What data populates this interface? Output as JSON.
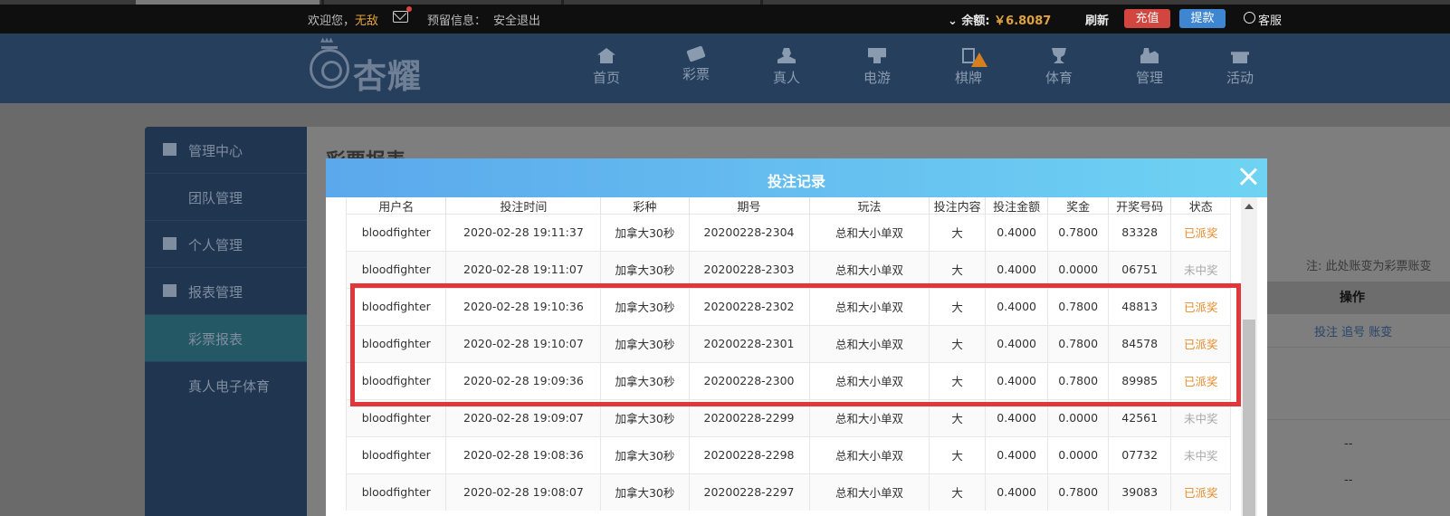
{
  "topbar": {
    "welcome_prefix": "欢迎您，",
    "username": "无敌",
    "reserve_label": "预留信息：",
    "logout": "安全退出",
    "balance_label": "余额:",
    "balance_amount": "￥6.8087",
    "refresh": "刷新",
    "recharge": "充值",
    "withdraw": "提款",
    "service": "客服"
  },
  "logo": {
    "text": "杏耀"
  },
  "nav": {
    "items": [
      {
        "label": "首页",
        "icon": "home-icon"
      },
      {
        "label": "彩票",
        "icon": "ticket-icon"
      },
      {
        "label": "真人",
        "icon": "person-icon"
      },
      {
        "label": "电游",
        "icon": "arcade-icon"
      },
      {
        "label": "棋牌",
        "icon": "card-icon"
      },
      {
        "label": "体育",
        "icon": "trophy-icon"
      },
      {
        "label": "管理",
        "icon": "group-icon"
      },
      {
        "label": "活动",
        "icon": "gift-icon"
      }
    ]
  },
  "sidebar": {
    "items": [
      {
        "label": "管理中心",
        "icon": "group-icon"
      },
      {
        "label": "团队管理"
      },
      {
        "label": "个人管理",
        "icon": "person-icon"
      },
      {
        "label": "报表管理",
        "icon": "clipboard-icon"
      },
      {
        "label": "彩票报表",
        "active": true
      },
      {
        "label": "真人电子体育"
      }
    ]
  },
  "main": {
    "title": "彩票报表",
    "note": "注: 此处账变为彩票账变",
    "operation_header": "操作",
    "row_links": "投注 追号 账变",
    "dash": "--"
  },
  "modal": {
    "title": "投注记录",
    "columns": [
      "用户名",
      "投注时间",
      "彩种",
      "期号",
      "玩法",
      "投注内容",
      "投注金额",
      "奖金",
      "开奖号码",
      "状态"
    ],
    "rows": [
      [
        "bloodfighter",
        "2020-02-28 19:11:37",
        "加拿大30秒",
        "20200228-2304",
        "总和大小单双",
        "大",
        "0.4000",
        "0.7800",
        "83328",
        "已派奖"
      ],
      [
        "bloodfighter",
        "2020-02-28 19:11:07",
        "加拿大30秒",
        "20200228-2303",
        "总和大小单双",
        "大",
        "0.4000",
        "0.0000",
        "06751",
        "未中奖"
      ],
      [
        "bloodfighter",
        "2020-02-28 19:10:36",
        "加拿大30秒",
        "20200228-2302",
        "总和大小单双",
        "大",
        "0.4000",
        "0.7800",
        "48813",
        "已派奖"
      ],
      [
        "bloodfighter",
        "2020-02-28 19:10:07",
        "加拿大30秒",
        "20200228-2301",
        "总和大小单双",
        "大",
        "0.4000",
        "0.7800",
        "84578",
        "已派奖"
      ],
      [
        "bloodfighter",
        "2020-02-28 19:09:36",
        "加拿大30秒",
        "20200228-2300",
        "总和大小单双",
        "大",
        "0.4000",
        "0.7800",
        "89985",
        "已派奖"
      ],
      [
        "bloodfighter",
        "2020-02-28 19:09:07",
        "加拿大30秒",
        "20200228-2299",
        "总和大小单双",
        "大",
        "0.4000",
        "0.0000",
        "42561",
        "未中奖"
      ],
      [
        "bloodfighter",
        "2020-02-28 19:08:36",
        "加拿大30秒",
        "20200228-2298",
        "总和大小单双",
        "大",
        "0.4000",
        "0.0000",
        "07732",
        "未中奖"
      ],
      [
        "bloodfighter",
        "2020-02-28 19:08:07",
        "加拿大30秒",
        "20200228-2297",
        "总和大小单双",
        "大",
        "0.4000",
        "0.7800",
        "39083",
        "已派奖"
      ]
    ]
  },
  "colors": {
    "paid": "#e58b2a",
    "unpaid": "#a8a8a8",
    "highlight": "#e2373a",
    "modal_header_start": "#5ba8ec",
    "modal_header_end": "#6fd3f3"
  }
}
